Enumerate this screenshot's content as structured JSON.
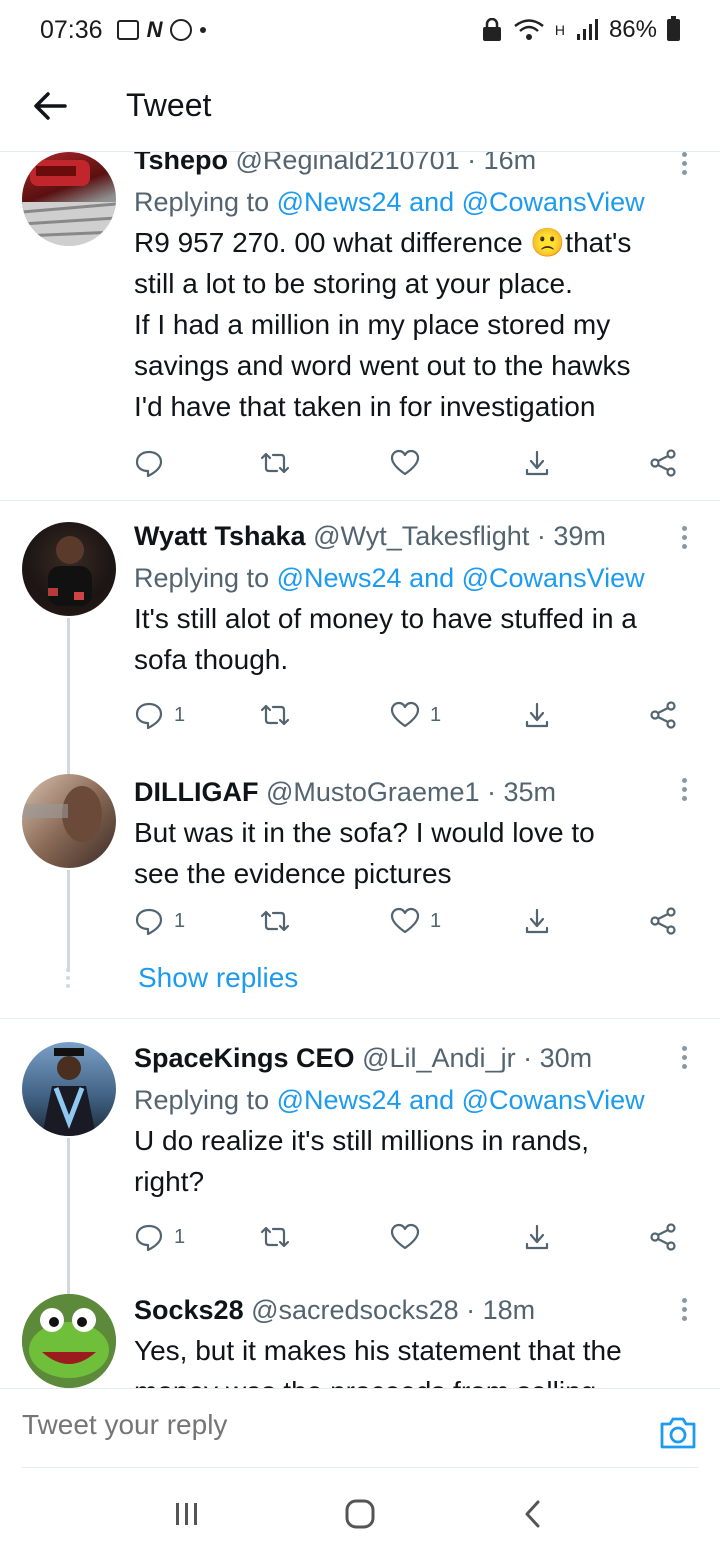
{
  "status_bar": {
    "time": "07:36",
    "battery": "86%",
    "network_label": "H"
  },
  "header": {
    "title": "Tweet"
  },
  "tweets": [
    {
      "name": "Tshepo",
      "handle": "@Reginald210701",
      "time": "16m",
      "replying_prefix": "Replying to",
      "replying_mentions": "@News24 and @CowansView",
      "text_lines": [
        "R9 957 270. 00 what difference 🙁that's",
        "still a lot to be storing at your place.",
        "If I had a million in my place stored my",
        "savings and word went out to the hawks",
        "I'd have that taken in for investigation"
      ],
      "reply_count": "",
      "like_count": ""
    },
    {
      "name": "Wyatt Tshaka",
      "handle": "@Wyt_Takesflight",
      "time": "39m",
      "replying_prefix": "Replying to",
      "replying_mentions": "@News24 and @CowansView",
      "text_lines": [
        "It's still alot of money to have stuffed in a",
        "sofa though."
      ],
      "reply_count": "1",
      "like_count": "1"
    },
    {
      "name": "DILLIGAF",
      "handle": "@MustoGraeme1",
      "time": "35m",
      "text_lines": [
        "But was it in the sofa? I would love to",
        "see the evidence pictures"
      ],
      "reply_count": "1",
      "like_count": "1",
      "show_replies": "Show replies"
    },
    {
      "name": "SpaceKings CEO",
      "handle": "@Lil_Andi_jr",
      "time": "30m",
      "replying_prefix": "Replying to",
      "replying_mentions": "@News24 and @CowansView",
      "text_lines": [
        "U do realize it's still millions in rands,",
        "right?"
      ],
      "reply_count": "1",
      "like_count": ""
    },
    {
      "name": "Socks28",
      "handle": "@sacredsocks28",
      "time": "18m",
      "text_lines": [
        "Yes, but it makes his statement that the",
        "money was the proceeds from selling"
      ]
    }
  ],
  "reply_bar": {
    "placeholder": "Tweet your reply"
  },
  "colors": {
    "accent": "#1d9bf0",
    "secondary_text": "#536471",
    "divider": "#e6ecf0"
  }
}
